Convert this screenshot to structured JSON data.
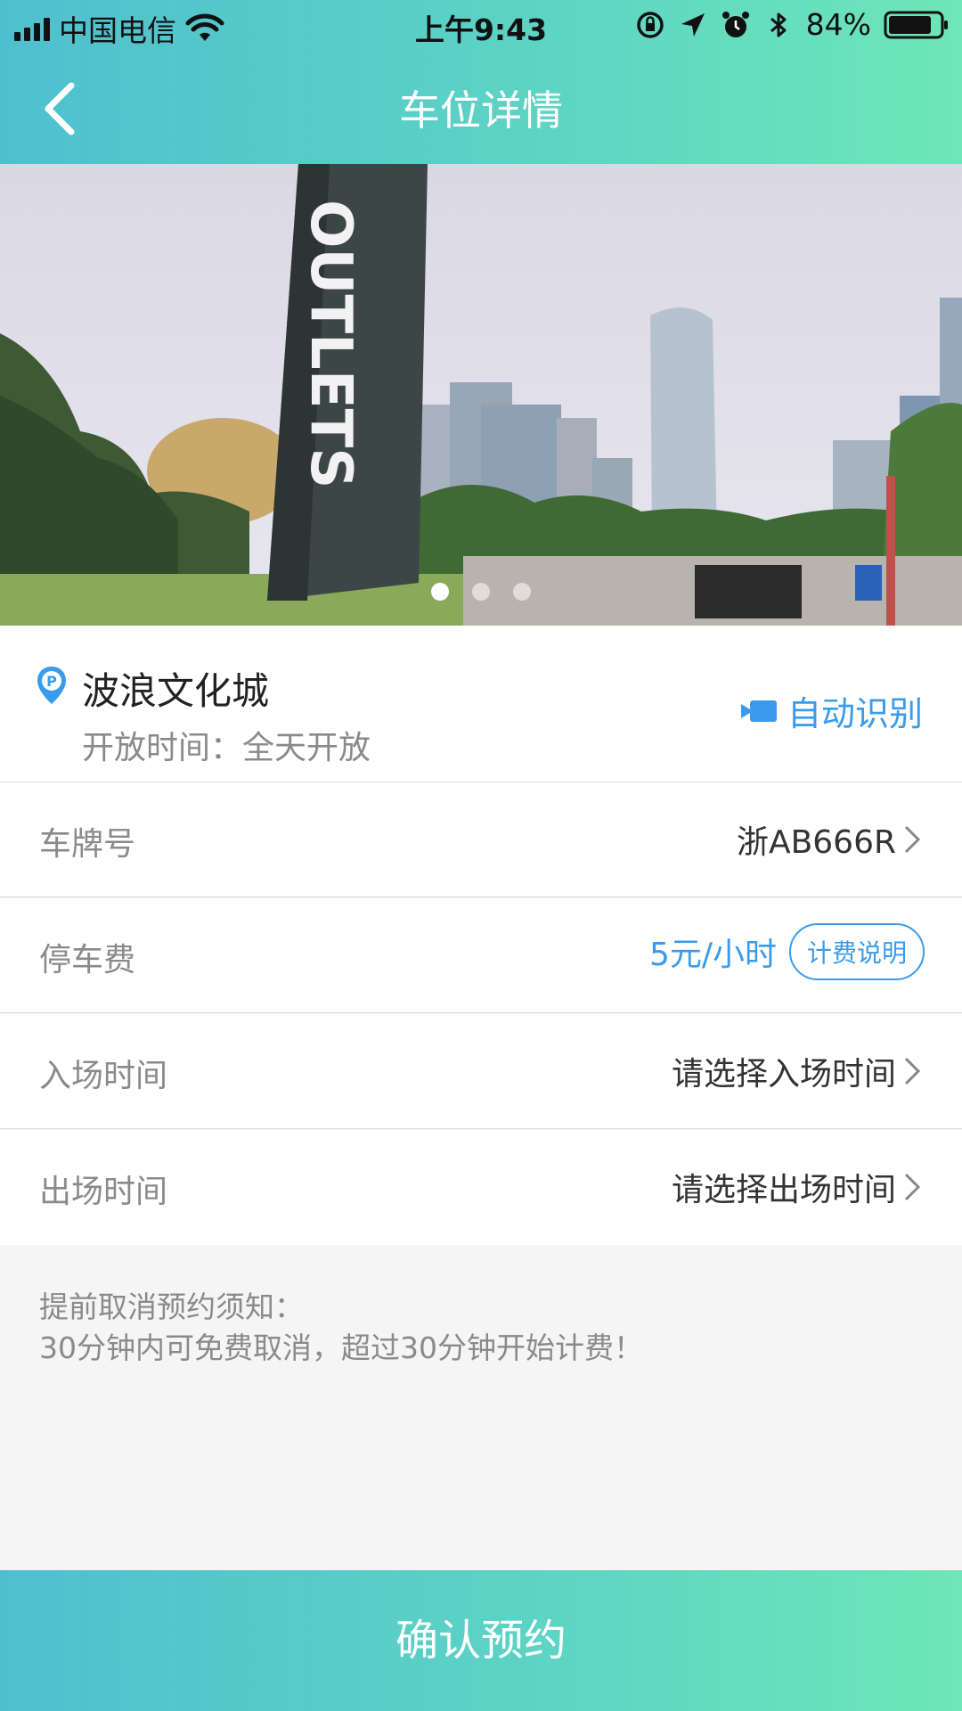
{
  "status_bar": {
    "carrier": "中国电信",
    "time": "上午9:43",
    "battery": "84%"
  },
  "nav": {
    "title": "车位详情"
  },
  "banner": {
    "sign_text": "OUTLETS",
    "slide_count": 3,
    "active_slide": 1
  },
  "lot": {
    "name": "波浪文化城",
    "hours": "开放时间：全天开放",
    "auto_recognize_label": "自动识别"
  },
  "rows": {
    "plate": {
      "label": "车牌号",
      "value": "浙AB666R"
    },
    "fee": {
      "label": "停车费",
      "value": "5元/小时",
      "button": "计费说明"
    },
    "entry": {
      "label": "入场时间",
      "value": "请选择入场时间"
    },
    "exit": {
      "label": "出场时间",
      "value": "请选择出场时间"
    }
  },
  "notice": {
    "title": "提前取消预约须知：",
    "text": "30分钟内可免费取消，超过30分钟开始计费！"
  },
  "confirm_label": "确认预约",
  "colors": {
    "gradient_start": "#4fbfcf",
    "gradient_end": "#6ee6b8",
    "accent_blue": "#3a9bec"
  }
}
